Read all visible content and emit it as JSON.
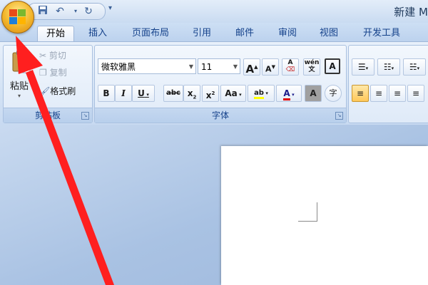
{
  "window": {
    "title": "新建 M"
  },
  "quick_access": {
    "save_icon": "save-icon",
    "undo_icon": "undo-icon",
    "redo_icon": "redo-icon",
    "customize_glyph": "▾"
  },
  "tabs": [
    {
      "label": "开始",
      "active": true
    },
    {
      "label": "插入"
    },
    {
      "label": "页面布局"
    },
    {
      "label": "引用"
    },
    {
      "label": "邮件"
    },
    {
      "label": "审阅"
    },
    {
      "label": "视图"
    },
    {
      "label": "开发工具"
    }
  ],
  "clipboard": {
    "group_label": "剪贴板",
    "paste_label": "粘贴",
    "cut_label": "剪切",
    "copy_label": "复制",
    "format_painter_label": "格式刷"
  },
  "font": {
    "group_label": "字体",
    "font_name": "微软雅黑",
    "font_size": "11",
    "grow_label": "A",
    "shrink_label": "A",
    "wen_label": "wén",
    "wen_char": "文",
    "clear_label": "A",
    "bold": "B",
    "italic": "I",
    "underline": "U",
    "strike": "abc",
    "subscript": "x",
    "superscript": "x",
    "subscript_index": "2",
    "superscript_index": "2",
    "change_case": "Aa",
    "highlight": "ab",
    "font_color": "A",
    "char_shading": "A",
    "enclose": "字"
  },
  "colors": {
    "highlight": "#ffff00",
    "font_color": "#e00000",
    "arrow": "#ff1f1f"
  }
}
